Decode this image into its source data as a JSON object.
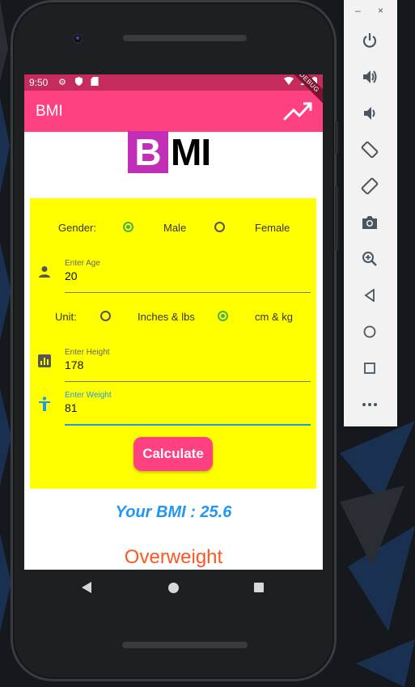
{
  "status_bar": {
    "time": "9:50"
  },
  "app_bar": {
    "title": "BMI",
    "debug_banner": "DEBUG"
  },
  "logo": {
    "letter_b": "B",
    "letters_mi": "MI"
  },
  "form": {
    "gender_label": "Gender:",
    "gender_options": [
      "Male",
      "Female"
    ],
    "gender_selected": "Male",
    "age": {
      "label": "Enter Age",
      "value": "20"
    },
    "unit_label": "Unit:",
    "unit_options": [
      "Inches & lbs",
      "cm & kg"
    ],
    "unit_selected": "cm & kg",
    "height": {
      "label": "Enter Height",
      "value": "178"
    },
    "weight": {
      "label": "Enter Weight",
      "value": "81"
    },
    "calculate_label": "Calculate"
  },
  "result": {
    "bmi_text": "Your BMI : 25.6",
    "category": "Overweight"
  },
  "emulator_panel": {
    "minimize": "–",
    "close": "×",
    "buttons": [
      "power-icon",
      "volume-up-icon",
      "volume-down-icon",
      "rotate-left-icon",
      "rotate-right-icon",
      "camera-icon",
      "zoom-icon",
      "back-icon",
      "home-icon",
      "overview-icon",
      "more-icon"
    ]
  },
  "colors": {
    "status_bar": "#c52c5c",
    "app_bar": "#ff4081",
    "form_bg": "#ffff00",
    "radio_selected": "#4caf50",
    "bmi_text": "#2196f3",
    "category_text": "#ff5722",
    "logo_b_bg": "#c12fb6"
  }
}
